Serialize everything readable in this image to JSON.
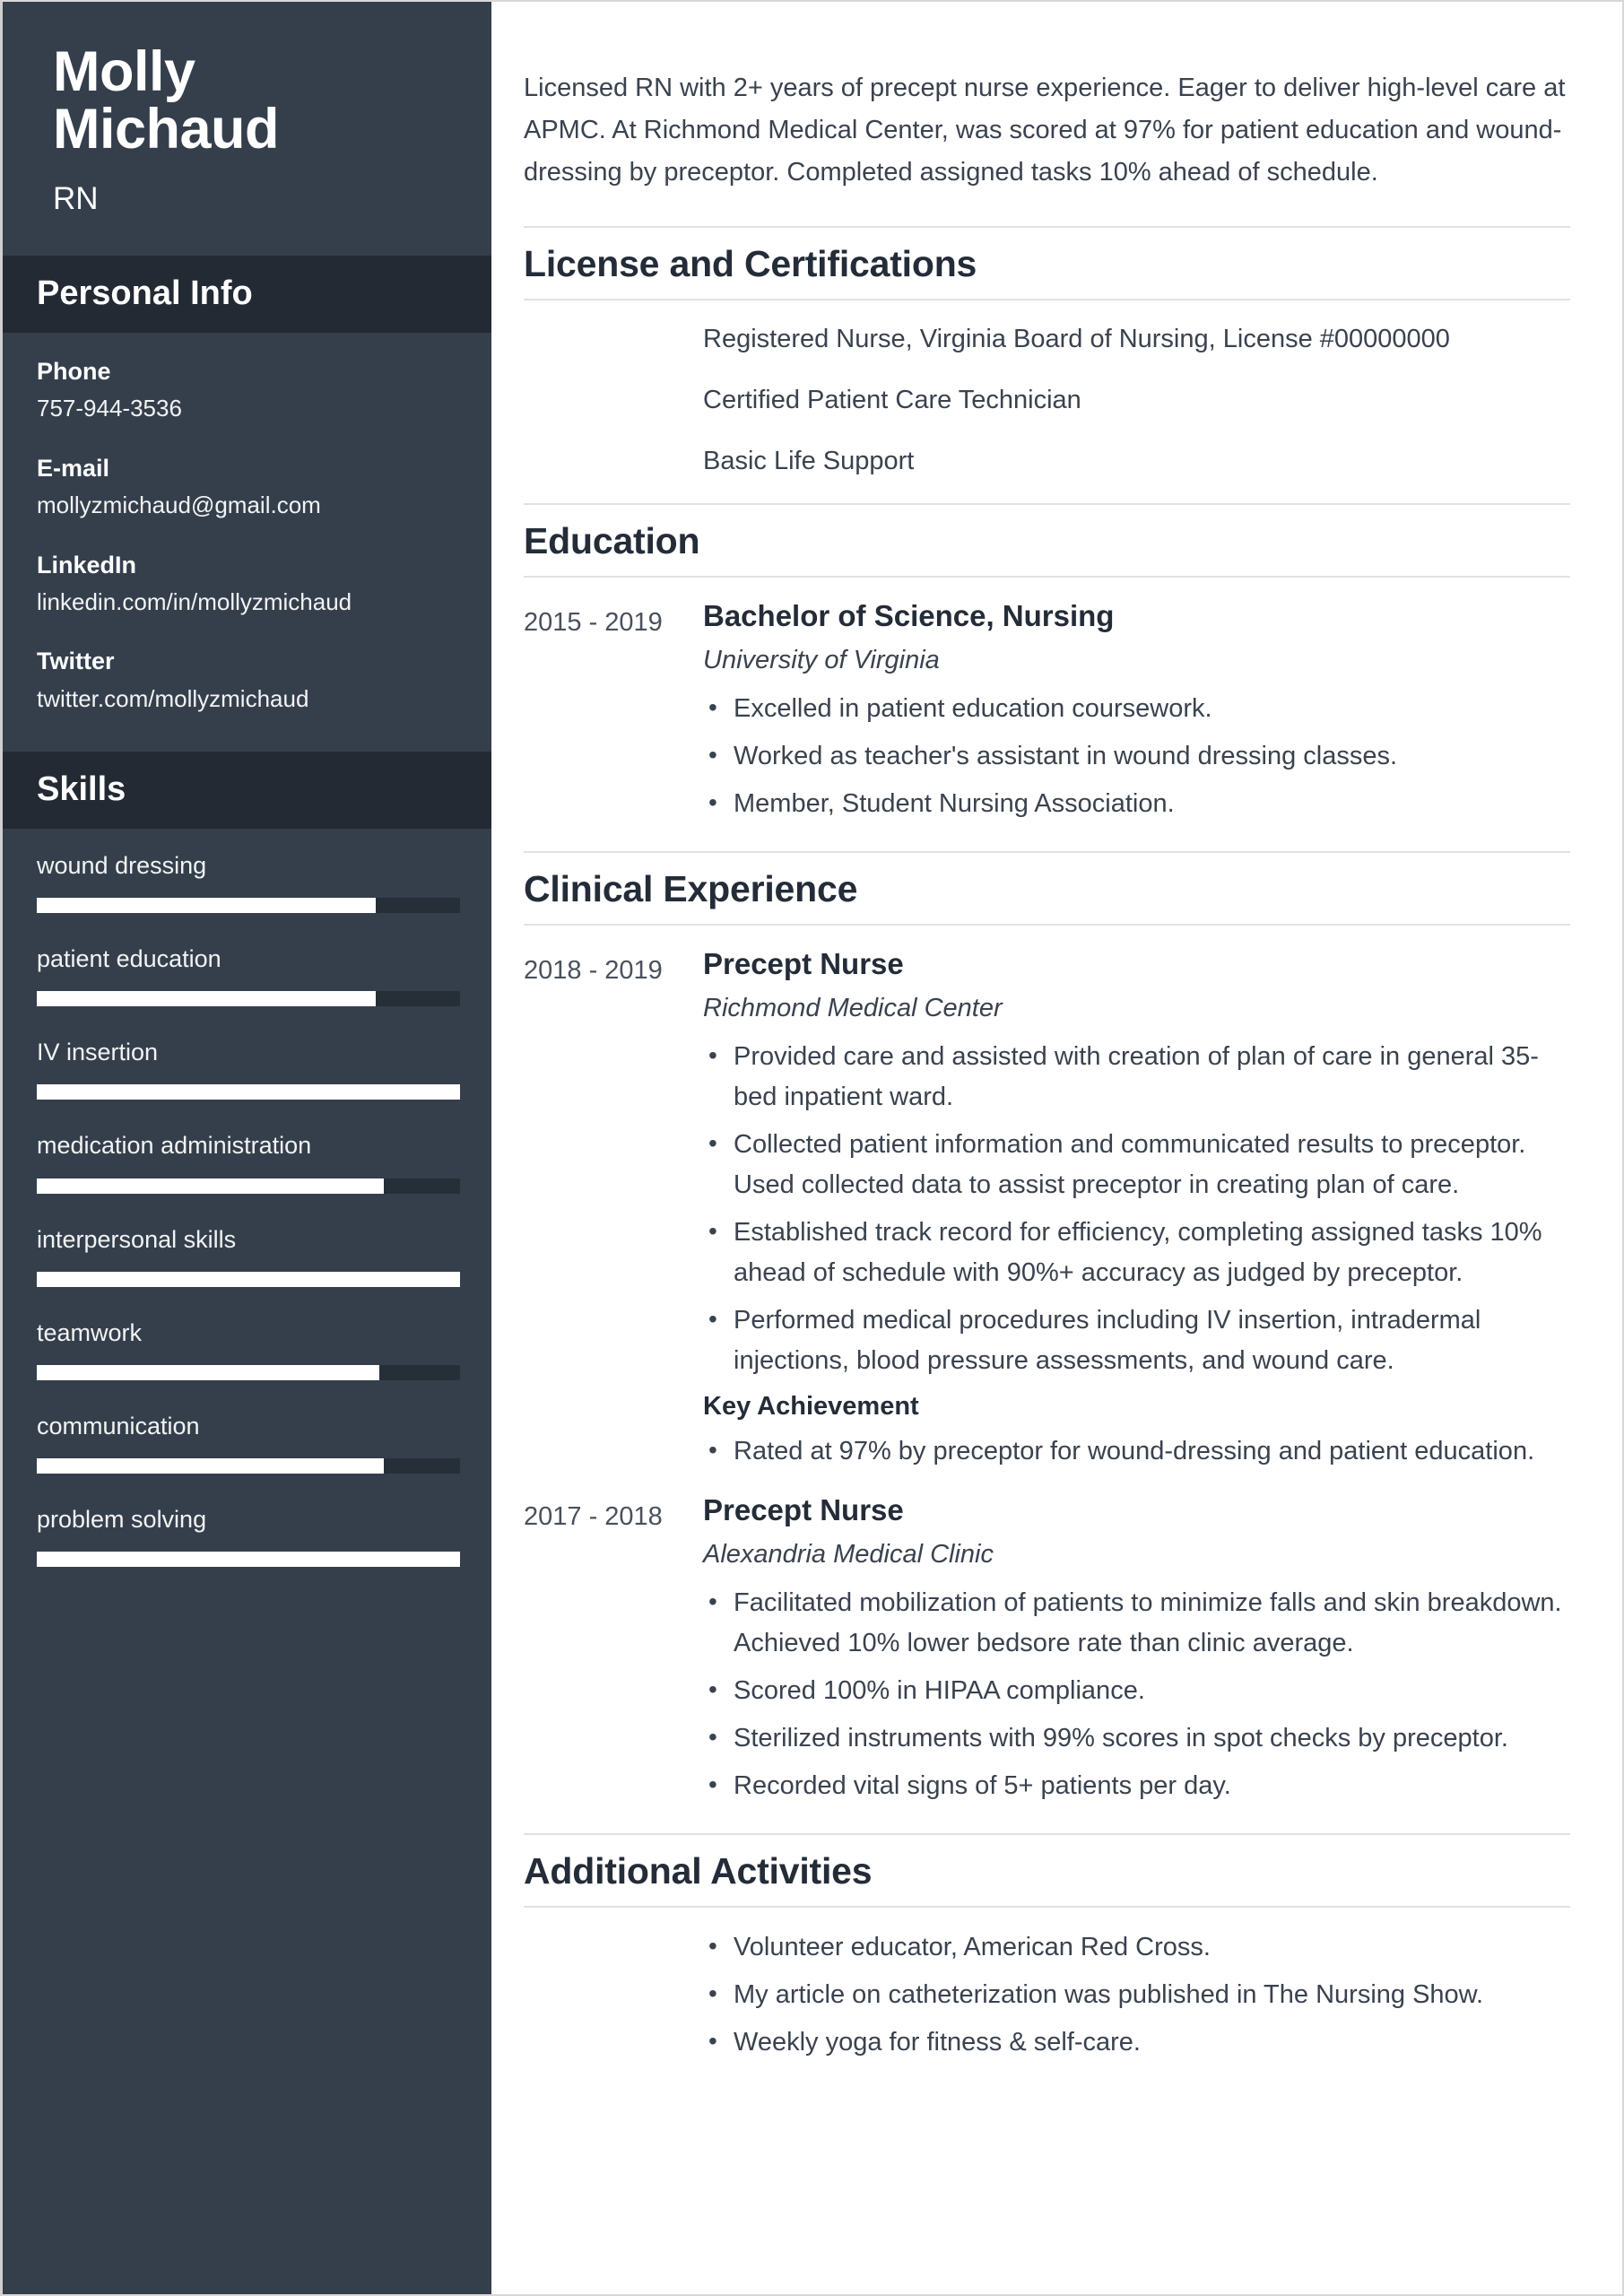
{
  "sidebar": {
    "first_name": "Molly",
    "last_name": "Michaud",
    "job_title": "RN",
    "personal_info_heading": "Personal Info",
    "contacts": [
      {
        "label": "Phone",
        "value": "757-944-3536"
      },
      {
        "label": "E-mail",
        "value": "mollyzmichaud@gmail.com"
      },
      {
        "label": "LinkedIn",
        "value": "linkedin.com/in/mollyzmichaud"
      },
      {
        "label": "Twitter",
        "value": "twitter.com/mollyzmichaud"
      }
    ],
    "skills_heading": "Skills",
    "skills": [
      {
        "label": "wound dressing",
        "level": 80
      },
      {
        "label": "patient education",
        "level": 80
      },
      {
        "label": "IV insertion",
        "level": 100
      },
      {
        "label": "medication administration",
        "level": 82
      },
      {
        "label": "interpersonal skills",
        "level": 100
      },
      {
        "label": "teamwork",
        "level": 81
      },
      {
        "label": "communication",
        "level": 82
      },
      {
        "label": "problem solving",
        "level": 100
      }
    ]
  },
  "main": {
    "summary": "Licensed RN with 2+ years of precept nurse experience. Eager to deliver high-level care at APMC. At Richmond Medical Center, was scored at 97% for patient education and wound-dressing by preceptor. Completed assigned tasks 10% ahead of schedule.",
    "license_section": {
      "title": "License and Certifications",
      "items": [
        "Registered Nurse, Virginia Board of Nursing, License #00000000",
        "Certified Patient Care Technician",
        "Basic Life Support"
      ]
    },
    "education_section": {
      "title": "Education",
      "entries": [
        {
          "dates": "2015 - 2019",
          "role": "Bachelor of Science, Nursing",
          "org": "University of Virginia",
          "bullets": [
            "Excelled in patient education coursework.",
            "Worked as teacher's assistant in wound dressing classes.",
            "Member, Student Nursing Association."
          ]
        }
      ]
    },
    "experience_section": {
      "title": "Clinical Experience",
      "entries": [
        {
          "dates": "2018 - 2019",
          "role": "Precept Nurse",
          "org": "Richmond Medical Center",
          "bullets": [
            "Provided care and assisted with creation of plan of care in general 35-bed inpatient ward.",
            "Collected patient information and communicated results to preceptor. Used collected data to assist preceptor in creating plan of care.",
            "Established track record for efficiency, completing assigned tasks 10% ahead of schedule with 90%+ accuracy as judged by preceptor.",
            "Performed medical procedures including IV insertion, intradermal injections, blood pressure assessments, and wound care."
          ],
          "key_achievement_label": "Key Achievement",
          "key_achievement_bullets": [
            "Rated at 97% by preceptor for wound-dressing and patient education."
          ]
        },
        {
          "dates": "2017 - 2018",
          "role": "Precept Nurse",
          "org": "Alexandria Medical Clinic",
          "bullets": [
            "Facilitated mobilization of patients to minimize falls and skin breakdown. Achieved 10% lower bedsore rate than clinic average.",
            "Scored 100% in HIPAA compliance.",
            "Sterilized instruments with 99% scores in spot checks by preceptor.",
            "Recorded vital signs of 5+ patients per day."
          ],
          "key_achievement_label": "",
          "key_achievement_bullets": []
        }
      ]
    },
    "activities_section": {
      "title": "Additional Activities",
      "items": [
        "Volunteer educator, American Red Cross.",
        "My article on catheterization was published in The Nursing Show.",
        "Weekly yoga for fitness & self-care."
      ]
    }
  },
  "colors": {
    "sidebar_bg": "#353f4c",
    "sidebar_heading_bg": "#232a33",
    "skill_track": "#262e38",
    "skill_fill": "#ffffff",
    "text_dark": "#242c38"
  }
}
